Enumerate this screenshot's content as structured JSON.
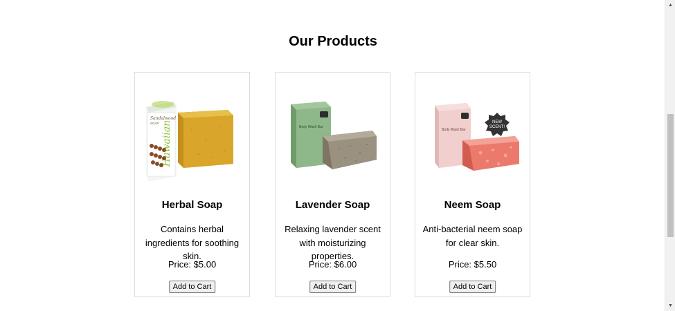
{
  "section": {
    "title": "Our Products"
  },
  "products": [
    {
      "name": "Herbal Soap",
      "description": "Contains herbal ingredients for soothing skin.",
      "price": "Price: $5.00",
      "button_label": "Add to Cart",
      "image_label_box_word": "Hawaiian",
      "image_label_scent": "Sandalwood",
      "image_label_type": "SOAP"
    },
    {
      "name": "Lavender Soap",
      "description": "Relaxing lavender scent with moisturizing properties.",
      "price": "Price: $6.00",
      "button_label": "Add to Cart",
      "image_label_box": "Body Wash Bar"
    },
    {
      "name": "Neem Soap",
      "description": "Anti-bacterial neem soap for clear skin.",
      "price": "Price: $5.50",
      "button_label": "Add to Cart",
      "image_label_box": "Body Wash Bar",
      "badge_line1": "NEW",
      "badge_line2": "SCENT!"
    }
  ],
  "colors": {
    "card_border": "#dddddd",
    "herbal_soap": "#d9a52a",
    "lavender_box": "#8fb88a",
    "lavender_soap": "#9b9180",
    "neem_box": "#f2cfcf",
    "neem_soap": "#ec7a6c",
    "badge": "#333333"
  },
  "scrollbar": {
    "up_icon": "triangle-up",
    "down_icon": "triangle-down"
  }
}
